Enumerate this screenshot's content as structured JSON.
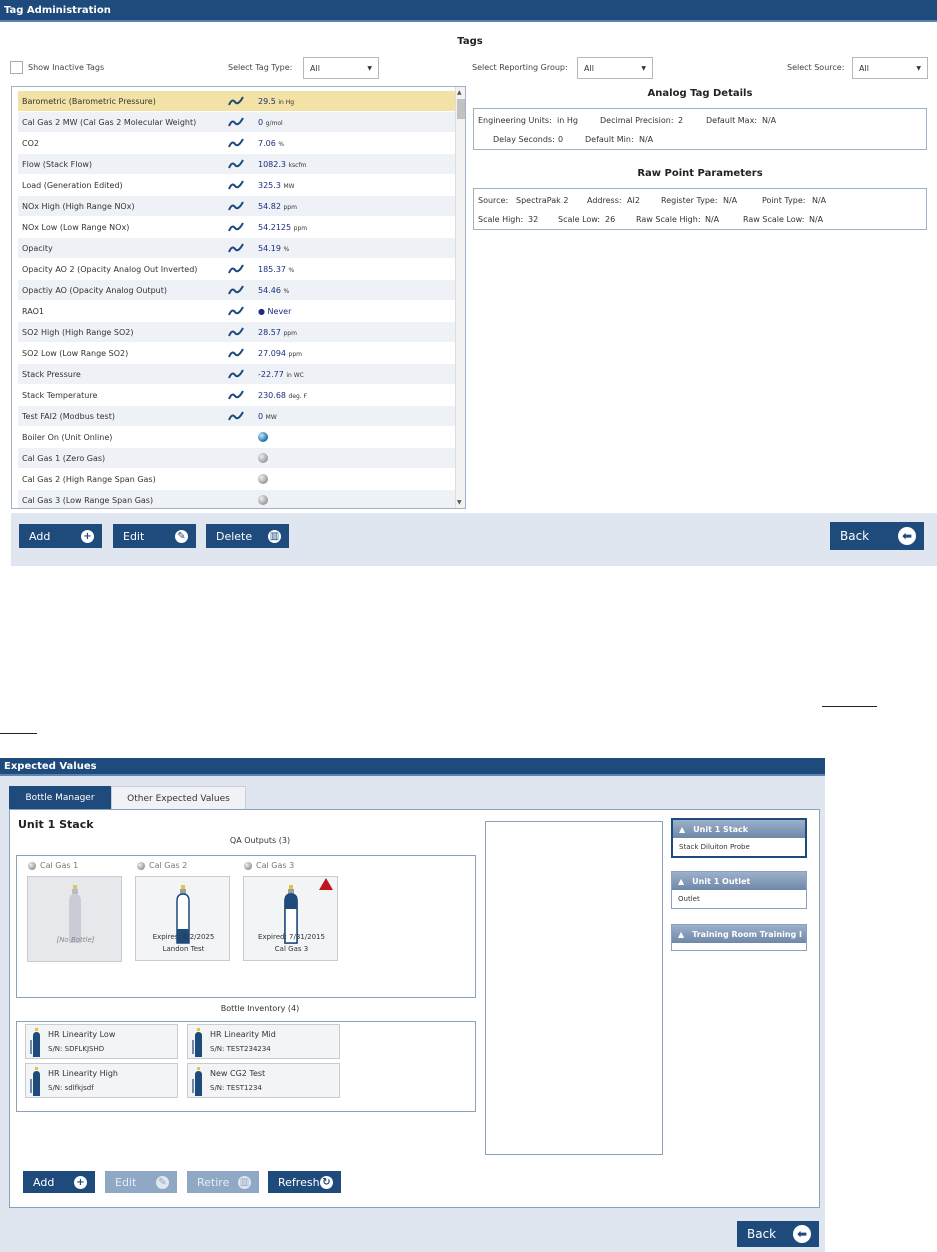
{
  "tag_admin": {
    "title": "Tag Administration",
    "tags_header": "Tags",
    "show_inactive_label": "Show Inactive Tags",
    "filters": {
      "tag_type_label": "Select Tag Type:",
      "tag_type_value": "All",
      "reporting_group_label": "Select Reporting Group:",
      "reporting_group_value": "All",
      "source_label": "Select Source:",
      "source_value": "All"
    },
    "tags": [
      {
        "name": "Barometric (Barometric Pressure)",
        "kind": "analog",
        "value": "29.5",
        "unit": "in Hg"
      },
      {
        "name": "Cal Gas 2 MW (Cal Gas 2 Molecular Weight)",
        "kind": "analog",
        "value": "0",
        "unit": "g/mol"
      },
      {
        "name": "CO2",
        "kind": "analog",
        "value": "7.06",
        "unit": "%"
      },
      {
        "name": "Flow (Stack Flow)",
        "kind": "analog",
        "value": "1082.3",
        "unit": "kscfm"
      },
      {
        "name": "Load (Generation Edited)",
        "kind": "analog",
        "value": "325.3",
        "unit": "MW"
      },
      {
        "name": "NOx High (High Range NOx)",
        "kind": "analog",
        "value": "54.82",
        "unit": "ppm"
      },
      {
        "name": "NOx Low (Low Range NOx)",
        "kind": "analog",
        "value": "54.2125",
        "unit": "ppm"
      },
      {
        "name": "Opacity",
        "kind": "analog",
        "value": "54.19",
        "unit": "%"
      },
      {
        "name": "Opacity AO 2 (Opacity Analog Out Inverted)",
        "kind": "analog",
        "value": "185.37",
        "unit": "%"
      },
      {
        "name": "Opactiy AO (Opacity Analog Output)",
        "kind": "analog",
        "value": "54.46",
        "unit": "%"
      },
      {
        "name": "RAO1",
        "kind": "never",
        "value": "Never",
        "unit": ""
      },
      {
        "name": "SO2 High (High Range SO2)",
        "kind": "analog",
        "value": "28.57",
        "unit": "ppm"
      },
      {
        "name": "SO2 Low (Low Range SO2)",
        "kind": "analog",
        "value": "27.094",
        "unit": "ppm"
      },
      {
        "name": "Stack Pressure",
        "kind": "analog",
        "value": "-22.77",
        "unit": "in WC"
      },
      {
        "name": "Stack Temperature",
        "kind": "analog",
        "value": "230.68",
        "unit": "deg. F"
      },
      {
        "name": "Test FAI2 (Modbus test)",
        "kind": "analog",
        "value": "0",
        "unit": "MW"
      },
      {
        "name": "Boiler On (Unit Online)",
        "kind": "digital-on",
        "value": "",
        "unit": ""
      },
      {
        "name": "Cal Gas 1 (Zero Gas)",
        "kind": "digital-off",
        "value": "",
        "unit": ""
      },
      {
        "name": "Cal Gas 2 (High Range Span Gas)",
        "kind": "digital-off",
        "value": "",
        "unit": ""
      },
      {
        "name": "Cal Gas 3 (Low Range Span Gas)",
        "kind": "digital-off",
        "value": "",
        "unit": ""
      }
    ],
    "analog_details": {
      "title": "Analog Tag Details",
      "eng_units_label": "Engineering Units:",
      "eng_units_value": "in Hg",
      "decimal_precision_label": "Decimal Precision:",
      "decimal_precision_value": "2",
      "default_max_label": "Default Max:",
      "default_max_value": "N/A",
      "delay_seconds_label": "Delay Seconds:",
      "delay_seconds_value": "0",
      "default_min_label": "Default Min:",
      "default_min_value": "N/A"
    },
    "raw_point": {
      "title": "Raw Point Parameters",
      "source_label": "Source:",
      "source_value": "SpectraPak 2",
      "address_label": "Address:",
      "address_value": "AI2",
      "register_type_label": "Register Type:",
      "register_type_value": "N/A",
      "point_type_label": "Point Type:",
      "point_type_value": "N/A",
      "scale_high_label": "Scale High:",
      "scale_high_value": "32",
      "scale_low_label": "Scale Low:",
      "scale_low_value": "26",
      "raw_scale_high_label": "Raw Scale High:",
      "raw_scale_high_value": "N/A",
      "raw_scale_low_label": "Raw Scale Low:",
      "raw_scale_low_value": "N/A"
    },
    "buttons": {
      "add": "Add",
      "edit": "Edit",
      "delete": "Delete",
      "back": "Back"
    }
  },
  "expected_values": {
    "title": "Expected Values",
    "tabs": [
      "Bottle Manager",
      "Other Expected Values"
    ],
    "unit_title": "Unit 1 Stack",
    "qa_outputs_title": "QA Outputs (3)",
    "qa_outputs": [
      {
        "label": "Cal Gas 1",
        "expires": "",
        "name": "[No Bottle]",
        "empty": true
      },
      {
        "label": "Cal Gas 2",
        "expires": "Expires: 6/2/2025",
        "name": "Landon Test",
        "empty": false
      },
      {
        "label": "Cal Gas 3",
        "expires": "Expired: 7/31/2015",
        "name": "Cal Gas 3",
        "empty": false,
        "warning": true
      }
    ],
    "inventory_title": "Bottle Inventory (4)",
    "inventory": [
      {
        "name": "HR Linearity Low",
        "serial": "S/N: SDFLKJSHD"
      },
      {
        "name": "HR Linearity Mid",
        "serial": "S/N: TEST234234"
      },
      {
        "name": "HR Linearity High",
        "serial": "S/N: sdlfkjsdf"
      },
      {
        "name": "New CG2 Test",
        "serial": "S/N: TEST1234"
      }
    ],
    "side_units": [
      {
        "name": "Unit 1 Stack",
        "sub": "Stack Diluiton Probe"
      },
      {
        "name": "Unit 1 Outlet",
        "sub": "Outlet"
      },
      {
        "name": "Training Room Training I",
        "sub": ""
      }
    ],
    "buttons": {
      "add": "Add",
      "edit": "Edit",
      "retire": "Retire",
      "refresh": "Refresh",
      "back": "Back"
    }
  }
}
